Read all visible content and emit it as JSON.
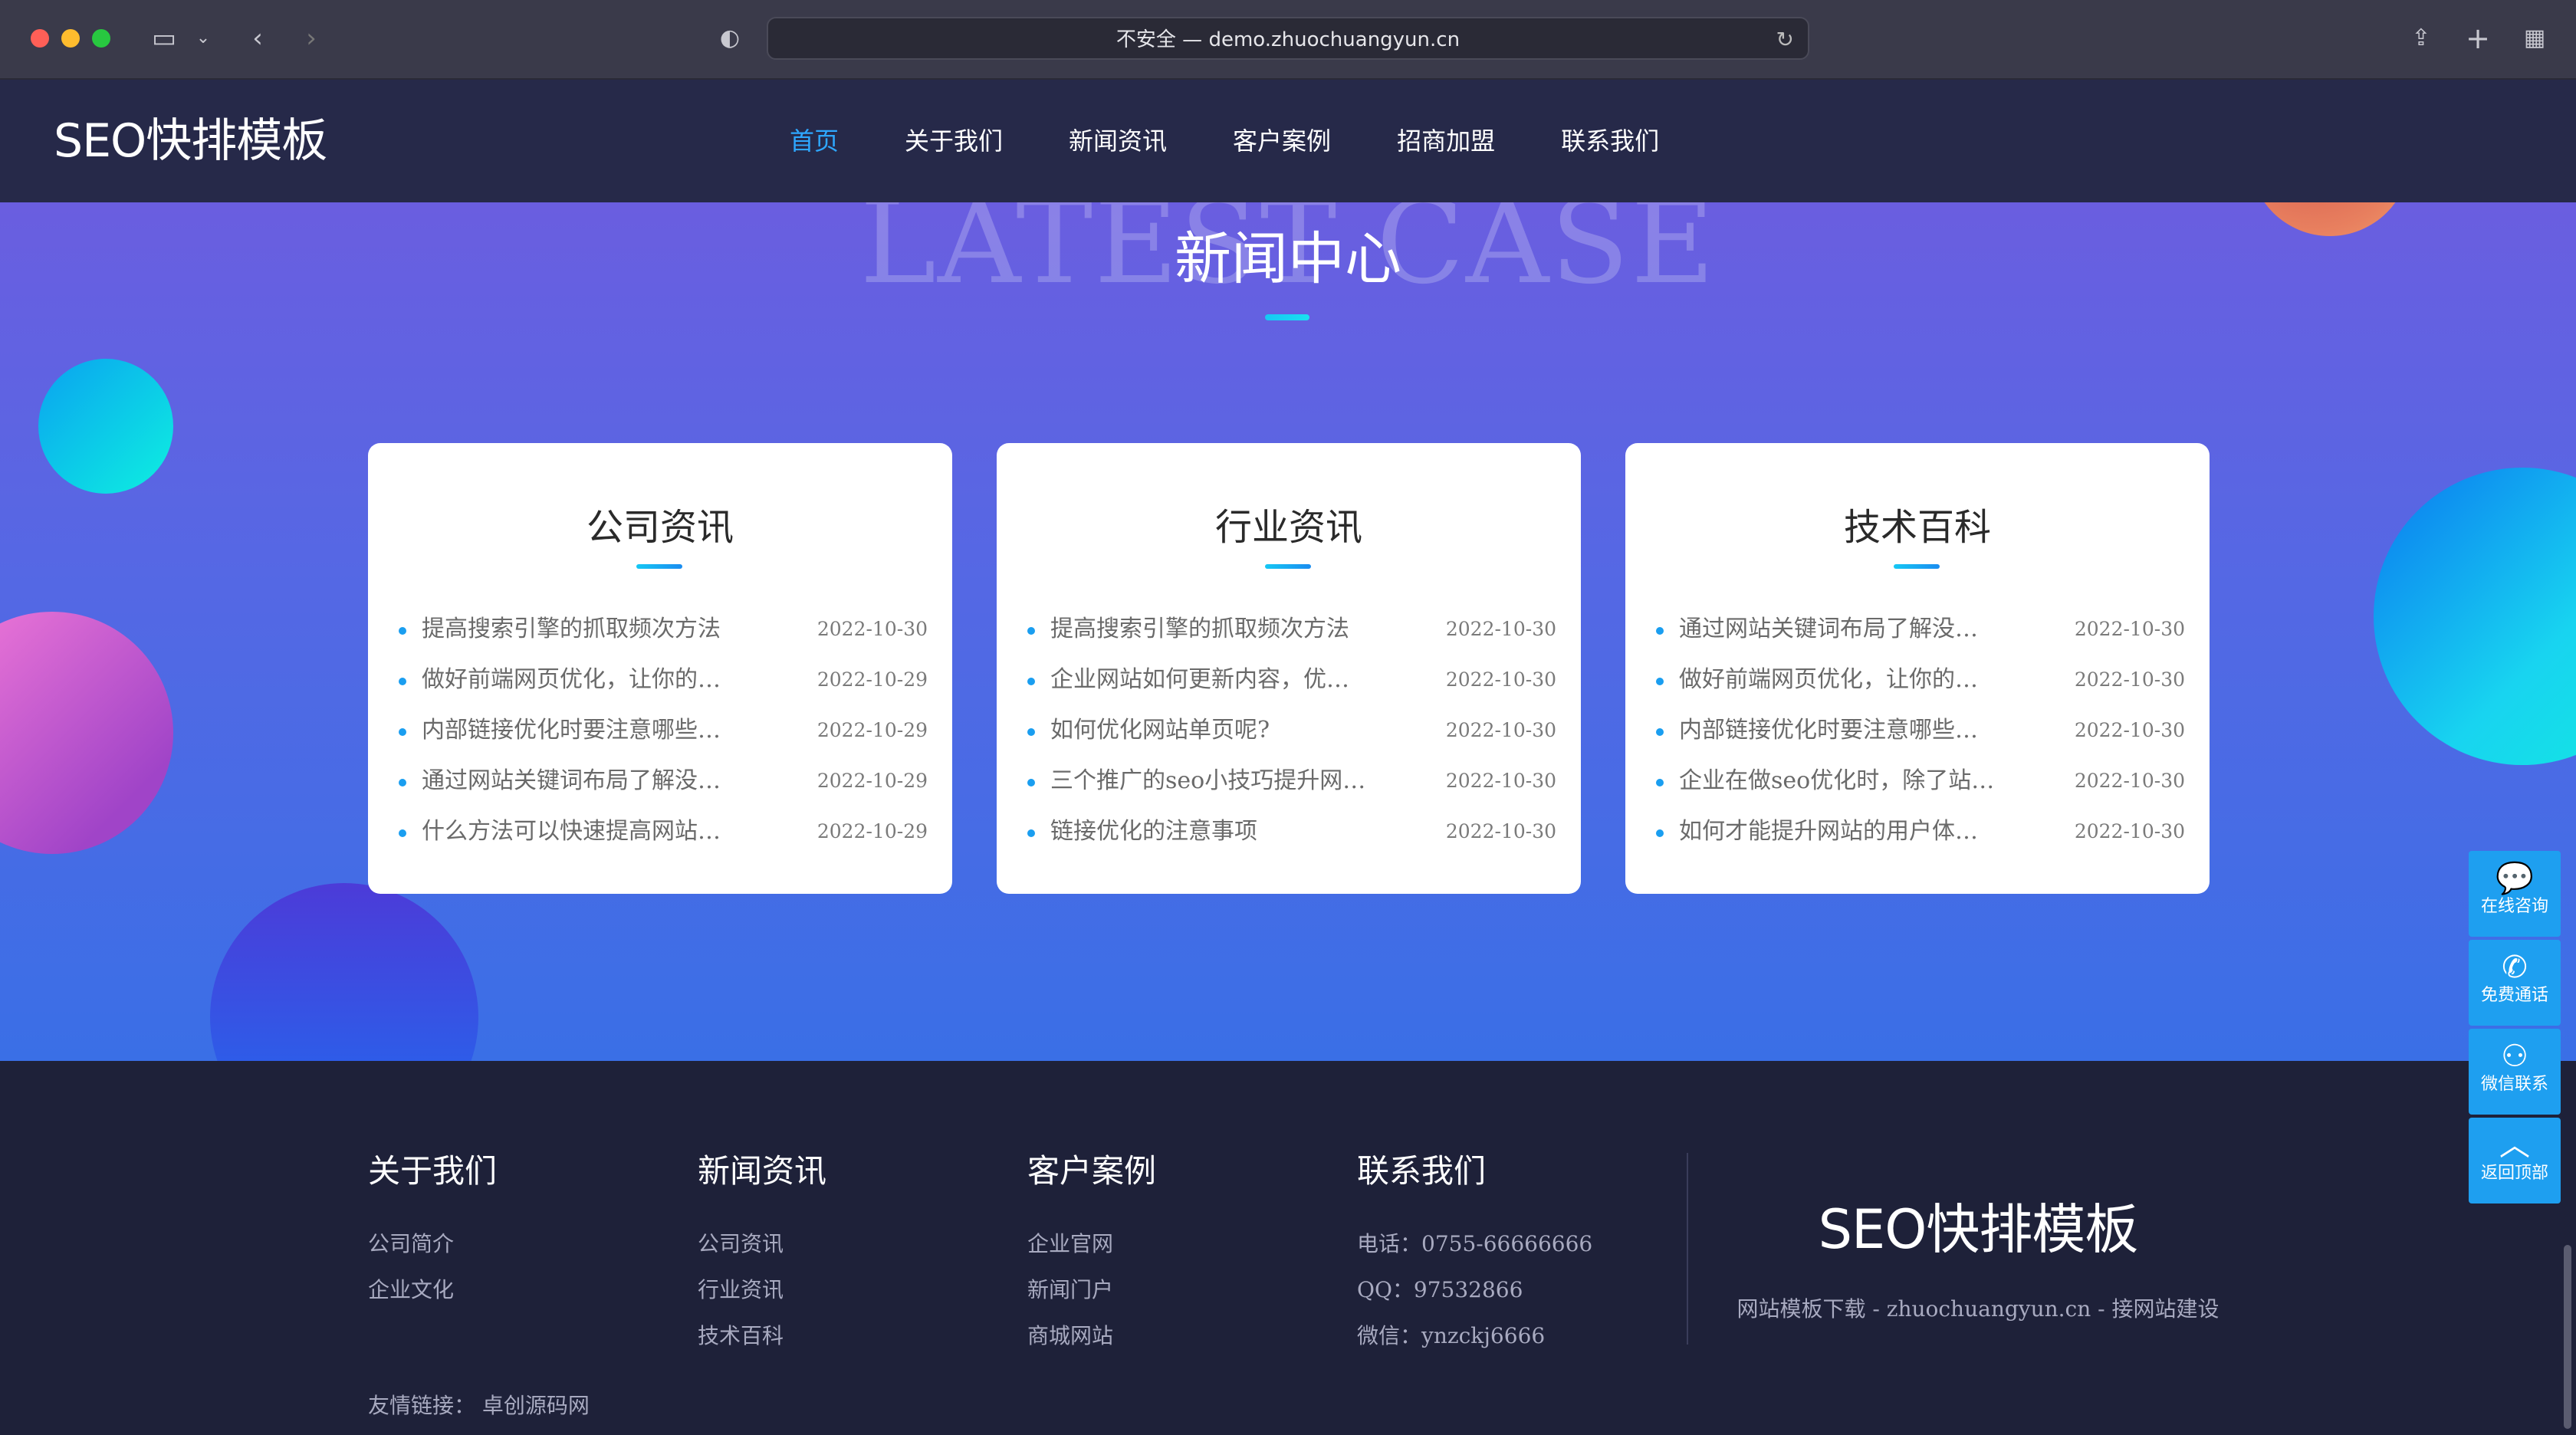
{
  "browser": {
    "url": "不安全 — demo.zhuochuangyun.cn",
    "icons": [
      "sidebar-icon",
      "chevron-down-icon",
      "back-icon",
      "forward-icon",
      "shield-icon",
      "reload-icon",
      "share-icon",
      "plus-icon",
      "tabs-grid-icon"
    ]
  },
  "header": {
    "logo": "SEO快排模板",
    "nav": [
      {
        "label": "首页",
        "active": true
      },
      {
        "label": "关于我们"
      },
      {
        "label": "新闻资讯"
      },
      {
        "label": "客户案例"
      },
      {
        "label": "招商加盟"
      },
      {
        "label": "联系我们"
      }
    ]
  },
  "hero": {
    "bg_title": "LATEST CASE",
    "title": "新闻中心"
  },
  "cards": [
    {
      "title": "公司资讯",
      "items": [
        {
          "title": "提高搜索引擎的抓取频次方法",
          "date": "2022-10-30"
        },
        {
          "title": "做好前端网页优化，让你的…",
          "date": "2022-10-29"
        },
        {
          "title": "内部链接优化时要注意哪些…",
          "date": "2022-10-29"
        },
        {
          "title": "通过网站关键词布局了解没…",
          "date": "2022-10-29"
        },
        {
          "title": "什么方法可以快速提高网站…",
          "date": "2022-10-29"
        }
      ]
    },
    {
      "title": "行业资讯",
      "items": [
        {
          "title": "提高搜索引擎的抓取频次方法",
          "date": "2022-10-30"
        },
        {
          "title": "企业网站如何更新内容，优…",
          "date": "2022-10-30"
        },
        {
          "title": "如何优化网站单页呢?",
          "date": "2022-10-30"
        },
        {
          "title": "三个推广的seo小技巧提升网…",
          "date": "2022-10-30"
        },
        {
          "title": "链接优化的注意事项",
          "date": "2022-10-30"
        }
      ]
    },
    {
      "title": "技术百科",
      "items": [
        {
          "title": "通过网站关键词布局了解没…",
          "date": "2022-10-30"
        },
        {
          "title": "做好前端网页优化，让你的…",
          "date": "2022-10-30"
        },
        {
          "title": "内部链接优化时要注意哪些…",
          "date": "2022-10-30"
        },
        {
          "title": "企业在做seo优化时，除了站…",
          "date": "2022-10-30"
        },
        {
          "title": "如何才能提升网站的用户体…",
          "date": "2022-10-30"
        }
      ]
    }
  ],
  "footer": {
    "columns": [
      {
        "title": "关于我们",
        "links": [
          "公司简介",
          "企业文化"
        ]
      },
      {
        "title": "新闻资讯",
        "links": [
          "公司资讯",
          "行业资讯",
          "技术百科"
        ]
      },
      {
        "title": "客户案例",
        "links": [
          "企业官网",
          "新闻门户",
          "商城网站"
        ]
      },
      {
        "title": "联系我们",
        "links": [
          "电话：0755-66666666",
          "QQ：97532866",
          "微信：ynzckj6666"
        ]
      }
    ],
    "logo": "SEO快排模板",
    "slogan": "网站模板下载 - zhuochuangyun.cn - 接网站建设",
    "friend_label": "友情链接：",
    "friend_link": "卓创源码网"
  },
  "side_buttons": [
    {
      "label": "在线咨询",
      "icon": "chat-bubble-icon"
    },
    {
      "label": "免费通话",
      "icon": "phone-icon"
    },
    {
      "label": "微信联系",
      "icon": "wechat-icon"
    },
    {
      "label": "返回顶部",
      "icon": "chevron-up-icon"
    }
  ],
  "colors": {
    "nav_active": "#2ea7ff",
    "accent": "#1e9ff0",
    "footer_bg": "#1e2139",
    "header_bg": "#262949"
  }
}
